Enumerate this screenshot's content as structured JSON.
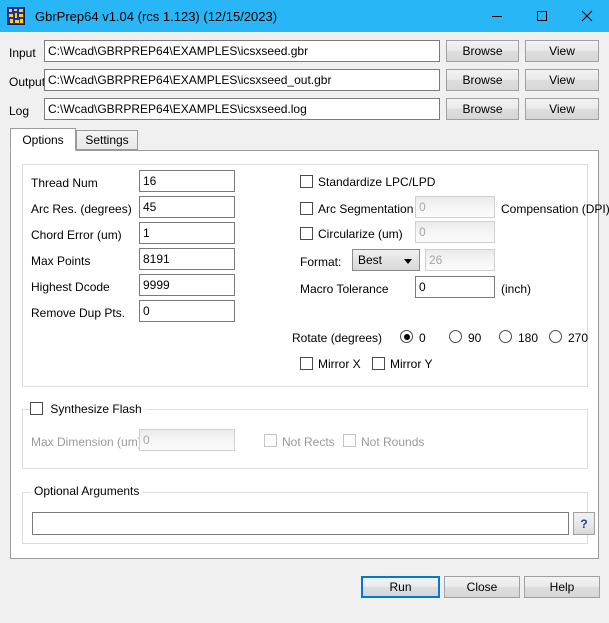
{
  "window": {
    "title": "GbrPrep64 v1.04 (rcs 1.123) (12/15/2023)",
    "icon": "pcb-pads-icon",
    "titlebar_color": "#29b6f6",
    "minimize": "minimize-icon",
    "maximize": "maximize-icon",
    "close": "close-icon"
  },
  "files": {
    "rows": [
      {
        "label": "Input",
        "value": "C:\\Wcad\\GBRPREP64\\EXAMPLES\\icsxseed.gbr",
        "browse_label": "Browse",
        "view_label": "View"
      },
      {
        "label": "Output",
        "value": "C:\\Wcad\\GBRPREP64\\EXAMPLES\\icsxseed_out.gbr",
        "browse_label": "Browse",
        "view_label": "View"
      },
      {
        "label": "Log",
        "value": "C:\\Wcad\\GBRPREP64\\EXAMPLES\\icsxseed.log",
        "browse_label": "Browse",
        "view_label": "View"
      }
    ]
  },
  "tabs": [
    {
      "label": "Options",
      "active": true
    },
    {
      "label": "Settings",
      "active": false
    }
  ],
  "options": {
    "left_fields": [
      {
        "label": "Thread Num",
        "value": "16"
      },
      {
        "label": "Arc Res. (degrees)",
        "value": "45"
      },
      {
        "label": "Chord Error (um)",
        "value": "1"
      },
      {
        "label": "Max Points",
        "value": "8191"
      },
      {
        "label": "Highest Dcode",
        "value": "9999"
      },
      {
        "label": "Remove Dup Pts.",
        "value": "0"
      }
    ],
    "standardize": {
      "label": "Standardize LPC/LPD",
      "checked": false
    },
    "arc_segmentation": {
      "label": "Arc Segmentation",
      "checked": false,
      "value": "0",
      "enabled": false
    },
    "compensation_label": "Compensation (DPI)",
    "circularize": {
      "label": "Circularize (um)",
      "checked": false,
      "value": "0",
      "enabled": false
    },
    "format": {
      "label": "Format:",
      "selected": "Best",
      "extra_value": "26",
      "extra_enabled": false
    },
    "macro_tolerance": {
      "label": "Macro Tolerance",
      "value": "0",
      "unit": "(inch)"
    },
    "rotate": {
      "label": "Rotate (degrees)",
      "options": [
        {
          "label": "0",
          "checked": true
        },
        {
          "label": "90",
          "checked": false
        },
        {
          "label": "180",
          "checked": false
        },
        {
          "label": "270",
          "checked": false
        }
      ]
    },
    "mirror_x": {
      "label": "Mirror X",
      "checked": false
    },
    "mirror_y": {
      "label": "Mirror Y",
      "checked": false
    }
  },
  "synthesize_flash": {
    "title": "Synthesize Flash",
    "checked": false,
    "max_dimension": {
      "label": "Max Dimension (um)",
      "value": "0",
      "enabled": false
    },
    "not_rects": {
      "label": "Not Rects",
      "checked": false,
      "enabled": false
    },
    "not_rounds": {
      "label": "Not Rounds",
      "checked": false,
      "enabled": false
    }
  },
  "optional_arguments": {
    "title": "Optional Arguments",
    "value": "",
    "help_label": "?"
  },
  "footer": {
    "run_label": "Run",
    "close_label": "Close",
    "help_label": "Help",
    "accent_color": "#0078d7"
  }
}
